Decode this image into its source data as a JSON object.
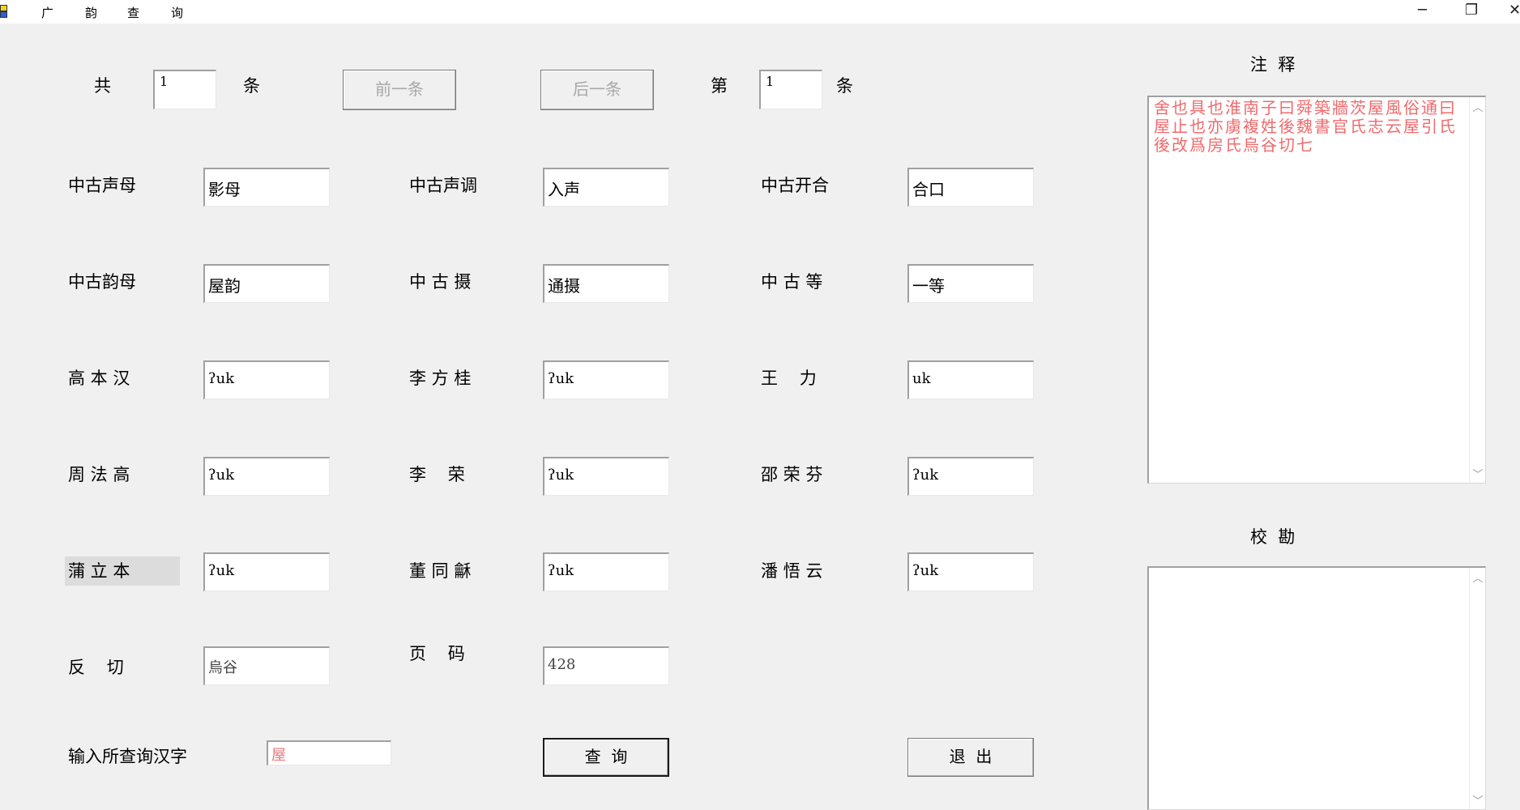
{
  "menu": {
    "items": [
      "广",
      "韵",
      "查",
      "询"
    ]
  },
  "window": {
    "minimize": "─",
    "restore": "❐",
    "close": "✕"
  },
  "nav": {
    "total_label": "共",
    "total_value": "1",
    "total_unit": "条",
    "prev_button": "前一条",
    "next_button": "后一条",
    "index_label": "第",
    "index_value": "1",
    "index_unit": "条"
  },
  "fields": {
    "mc_initial": {
      "label": "中古声母",
      "value": "影母"
    },
    "mc_tone": {
      "label": "中古声调",
      "value": "入声"
    },
    "mc_openness": {
      "label": "中古开合",
      "value": "合口"
    },
    "mc_final": {
      "label": "中古韵母",
      "value": "屋韵"
    },
    "mc_she": {
      "label": "中 古 摄",
      "value": "通摄"
    },
    "mc_grade": {
      "label": "中 古 等",
      "value": "一等"
    },
    "karlgren": {
      "label": "高 本 汉",
      "value": "ʔuk"
    },
    "li_fanggui": {
      "label": "李 方 桂",
      "value": "ʔuk"
    },
    "wang_li": {
      "label": "王    力",
      "value": "uk"
    },
    "zhou_fagao": {
      "label": "周 法 高",
      "value": "ʔuk"
    },
    "li_rong": {
      "label": "李    荣",
      "value": "ʔuk"
    },
    "shao_rongfen": {
      "label": "邵 荣 芬",
      "value": "ʔuk"
    },
    "pulleyblank": {
      "label": "蒲 立 本",
      "value": "ʔuk"
    },
    "dong_tonghe": {
      "label": "董 同 龢",
      "value": "ʔuk"
    },
    "pan_wuyun": {
      "label": "潘 悟 云",
      "value": "ʔuk"
    },
    "fanqie": {
      "label": "反    切",
      "value": "烏谷"
    },
    "page": {
      "label": "页    码",
      "value": "428"
    }
  },
  "query": {
    "label": "输入所查询汉字",
    "value": "屋",
    "search_button": "查  询",
    "exit_button": "退  出"
  },
  "notes": {
    "title": "注  释",
    "text": "舍也具也淮南子曰舜築牆茨屋風俗通曰屋止也亦虜複姓後魏書官氏志云屋引氏後改爲房氏烏谷切七"
  },
  "collation": {
    "title": "校  勘",
    "text": ""
  },
  "colors": {
    "background": "#f0f0f0",
    "note_text": "#f06a6c",
    "query_text": "#e8787a"
  }
}
